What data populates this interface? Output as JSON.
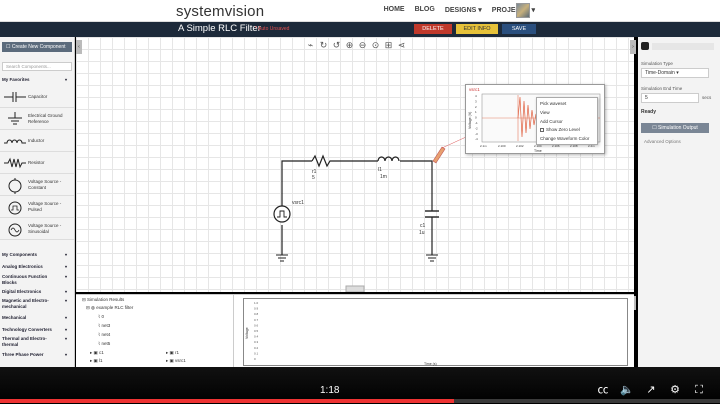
{
  "header": {
    "brand": "systemvision",
    "nav": [
      "HOME",
      "BLOG",
      "DESIGNS ▾",
      "PROJECTS ▾"
    ],
    "avatar_caret": "▾"
  },
  "titlebar": {
    "title": "A Simple RLC Filter",
    "autosave": "* Auto Unsaved",
    "delete_label": "DELETE",
    "edit_label": "EDIT INFO",
    "save_label": "SAVE"
  },
  "sidebar": {
    "create_label": "☐ Create New Component",
    "search_placeholder": "Search Components...",
    "favorites_label": "My Favorites",
    "components": [
      {
        "label": "Capacitor"
      },
      {
        "label": "Electrical Ground Reference"
      },
      {
        "label": "Inductor"
      },
      {
        "label": "Resistor"
      },
      {
        "label": "Voltage Source - Constant"
      },
      {
        "label": "Voltage Source - Pulsed"
      },
      {
        "label": "Voltage Source - Sinusoidal"
      }
    ],
    "categories": [
      "My Components",
      "Analog Electronics",
      "Continuous Function Blocks",
      "Digital Electronics",
      "Magnetic and Electro-mechanical",
      "Mechanical",
      "Technology Converters",
      "Thermal and Electro-thermal",
      "Three Phase Power"
    ]
  },
  "schematic": {
    "r1_label": "r1",
    "r1_value": "5",
    "l1_label": "l1",
    "l1_value": "1m",
    "c1_label": "c1",
    "c1_value": "1u",
    "source_label": "vsrc1"
  },
  "graph_popup": {
    "title": "vsrc1",
    "ylabel": "Voltage (V)",
    "xlabel": "Time",
    "yticks": [
      "4",
      "3",
      "2",
      "1",
      "0",
      "-1",
      "-2",
      "-3",
      "-4"
    ],
    "xticks": [
      "2.1m",
      "2.100",
      "2.102",
      "2.104",
      "2.106",
      "2.108",
      "2.2m"
    ],
    "menu": [
      "Pick waveset",
      "View",
      "Add Cursor",
      "Show Zero Level",
      "Change Waveform Color"
    ]
  },
  "right_panel": {
    "sim_type_label": "Simulation Type",
    "sim_type_value": "Time-Domain ▾",
    "end_time_label": "Simulation End Time",
    "end_time_value": "5",
    "end_time_unit": "secs",
    "ready": "Ready",
    "output_label": "☐ Simulation Output",
    "advanced": "Advanced Options"
  },
  "results": {
    "tree": [
      "⊟ Simulation Results",
      "⊟ ◍ example RLC filter",
      "0",
      "net3",
      "net4",
      "net5",
      "c1",
      "l1",
      "r1",
      "vsrc1"
    ],
    "plot_ylabel": "Voltage",
    "plot_xlabel": "Time (s)",
    "plot_yticks": [
      "1.0",
      "0.9",
      "0.8",
      "0.7",
      "0.6",
      "0.5",
      "0.4",
      "0.3",
      "0.2",
      "0.1",
      "0"
    ]
  },
  "video": {
    "timestamp": "1:18",
    "progress": 0.63
  }
}
